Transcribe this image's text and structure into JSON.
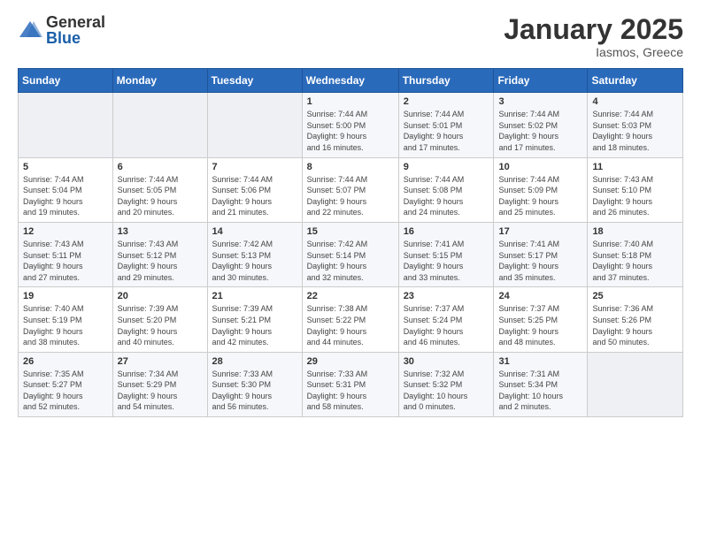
{
  "header": {
    "logo": {
      "general": "General",
      "blue": "Blue"
    },
    "title": "January 2025",
    "location": "Iasmos, Greece"
  },
  "calendar": {
    "headers": [
      "Sunday",
      "Monday",
      "Tuesday",
      "Wednesday",
      "Thursday",
      "Friday",
      "Saturday"
    ],
    "weeks": [
      [
        {
          "day": "",
          "info": ""
        },
        {
          "day": "",
          "info": ""
        },
        {
          "day": "",
          "info": ""
        },
        {
          "day": "1",
          "info": "Sunrise: 7:44 AM\nSunset: 5:00 PM\nDaylight: 9 hours\nand 16 minutes."
        },
        {
          "day": "2",
          "info": "Sunrise: 7:44 AM\nSunset: 5:01 PM\nDaylight: 9 hours\nand 17 minutes."
        },
        {
          "day": "3",
          "info": "Sunrise: 7:44 AM\nSunset: 5:02 PM\nDaylight: 9 hours\nand 17 minutes."
        },
        {
          "day": "4",
          "info": "Sunrise: 7:44 AM\nSunset: 5:03 PM\nDaylight: 9 hours\nand 18 minutes."
        }
      ],
      [
        {
          "day": "5",
          "info": "Sunrise: 7:44 AM\nSunset: 5:04 PM\nDaylight: 9 hours\nand 19 minutes."
        },
        {
          "day": "6",
          "info": "Sunrise: 7:44 AM\nSunset: 5:05 PM\nDaylight: 9 hours\nand 20 minutes."
        },
        {
          "day": "7",
          "info": "Sunrise: 7:44 AM\nSunset: 5:06 PM\nDaylight: 9 hours\nand 21 minutes."
        },
        {
          "day": "8",
          "info": "Sunrise: 7:44 AM\nSunset: 5:07 PM\nDaylight: 9 hours\nand 22 minutes."
        },
        {
          "day": "9",
          "info": "Sunrise: 7:44 AM\nSunset: 5:08 PM\nDaylight: 9 hours\nand 24 minutes."
        },
        {
          "day": "10",
          "info": "Sunrise: 7:44 AM\nSunset: 5:09 PM\nDaylight: 9 hours\nand 25 minutes."
        },
        {
          "day": "11",
          "info": "Sunrise: 7:43 AM\nSunset: 5:10 PM\nDaylight: 9 hours\nand 26 minutes."
        }
      ],
      [
        {
          "day": "12",
          "info": "Sunrise: 7:43 AM\nSunset: 5:11 PM\nDaylight: 9 hours\nand 27 minutes."
        },
        {
          "day": "13",
          "info": "Sunrise: 7:43 AM\nSunset: 5:12 PM\nDaylight: 9 hours\nand 29 minutes."
        },
        {
          "day": "14",
          "info": "Sunrise: 7:42 AM\nSunset: 5:13 PM\nDaylight: 9 hours\nand 30 minutes."
        },
        {
          "day": "15",
          "info": "Sunrise: 7:42 AM\nSunset: 5:14 PM\nDaylight: 9 hours\nand 32 minutes."
        },
        {
          "day": "16",
          "info": "Sunrise: 7:41 AM\nSunset: 5:15 PM\nDaylight: 9 hours\nand 33 minutes."
        },
        {
          "day": "17",
          "info": "Sunrise: 7:41 AM\nSunset: 5:17 PM\nDaylight: 9 hours\nand 35 minutes."
        },
        {
          "day": "18",
          "info": "Sunrise: 7:40 AM\nSunset: 5:18 PM\nDaylight: 9 hours\nand 37 minutes."
        }
      ],
      [
        {
          "day": "19",
          "info": "Sunrise: 7:40 AM\nSunset: 5:19 PM\nDaylight: 9 hours\nand 38 minutes."
        },
        {
          "day": "20",
          "info": "Sunrise: 7:39 AM\nSunset: 5:20 PM\nDaylight: 9 hours\nand 40 minutes."
        },
        {
          "day": "21",
          "info": "Sunrise: 7:39 AM\nSunset: 5:21 PM\nDaylight: 9 hours\nand 42 minutes."
        },
        {
          "day": "22",
          "info": "Sunrise: 7:38 AM\nSunset: 5:22 PM\nDaylight: 9 hours\nand 44 minutes."
        },
        {
          "day": "23",
          "info": "Sunrise: 7:37 AM\nSunset: 5:24 PM\nDaylight: 9 hours\nand 46 minutes."
        },
        {
          "day": "24",
          "info": "Sunrise: 7:37 AM\nSunset: 5:25 PM\nDaylight: 9 hours\nand 48 minutes."
        },
        {
          "day": "25",
          "info": "Sunrise: 7:36 AM\nSunset: 5:26 PM\nDaylight: 9 hours\nand 50 minutes."
        }
      ],
      [
        {
          "day": "26",
          "info": "Sunrise: 7:35 AM\nSunset: 5:27 PM\nDaylight: 9 hours\nand 52 minutes."
        },
        {
          "day": "27",
          "info": "Sunrise: 7:34 AM\nSunset: 5:29 PM\nDaylight: 9 hours\nand 54 minutes."
        },
        {
          "day": "28",
          "info": "Sunrise: 7:33 AM\nSunset: 5:30 PM\nDaylight: 9 hours\nand 56 minutes."
        },
        {
          "day": "29",
          "info": "Sunrise: 7:33 AM\nSunset: 5:31 PM\nDaylight: 9 hours\nand 58 minutes."
        },
        {
          "day": "30",
          "info": "Sunrise: 7:32 AM\nSunset: 5:32 PM\nDaylight: 10 hours\nand 0 minutes."
        },
        {
          "day": "31",
          "info": "Sunrise: 7:31 AM\nSunset: 5:34 PM\nDaylight: 10 hours\nand 2 minutes."
        },
        {
          "day": "",
          "info": ""
        }
      ]
    ]
  }
}
